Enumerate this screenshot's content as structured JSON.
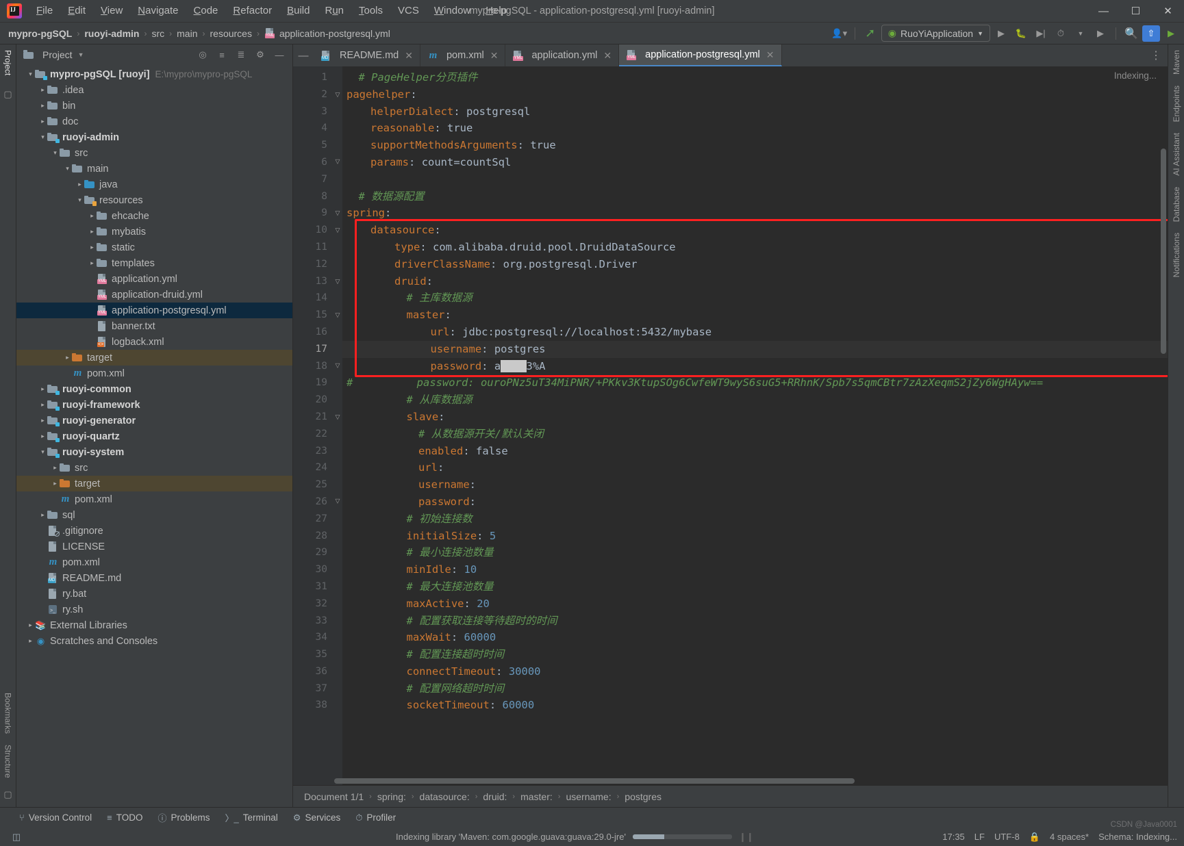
{
  "titlebar": {
    "logo_icon": "intellij-logo-icon",
    "title": "mypro-pgSQL - application-postgresql.yml [ruoyi-admin]",
    "menus": [
      {
        "label": "File",
        "mnemonic": "F"
      },
      {
        "label": "Edit",
        "mnemonic": "E"
      },
      {
        "label": "View",
        "mnemonic": "V"
      },
      {
        "label": "Navigate",
        "mnemonic": "N"
      },
      {
        "label": "Code",
        "mnemonic": "C"
      },
      {
        "label": "Refactor",
        "mnemonic": "R"
      },
      {
        "label": "Build",
        "mnemonic": "B"
      },
      {
        "label": "Run",
        "mnemonic": "u"
      },
      {
        "label": "Tools",
        "mnemonic": "T"
      },
      {
        "label": "VCS",
        "mnemonic": "V"
      },
      {
        "label": "Window",
        "mnemonic": "W"
      },
      {
        "label": "Help",
        "mnemonic": "H"
      }
    ],
    "window_controls": {
      "minimize": "—",
      "maximize": "☐",
      "close": "✕"
    }
  },
  "navbar": {
    "crumbs": [
      "mypro-pgSQL",
      "ruoyi-admin",
      "src",
      "main",
      "resources",
      "application-postgresql.yml"
    ],
    "separator": "›",
    "run_config": "RuoYiApplication",
    "icons": [
      "user-dropdown-icon",
      "update-project-icon",
      "run-icon",
      "debug-icon",
      "run-coverage-icon",
      "profiler-icon",
      "more-run-icon",
      "run-anything-icon",
      "search-icon",
      "updates-icon",
      "ide-icon"
    ]
  },
  "left_strip": {
    "tabs": [
      "Project",
      "Bookmarks",
      "Structure"
    ],
    "commit_icon": "commit-icon"
  },
  "right_strip": {
    "tabs": [
      "Maven",
      "Endpoints",
      "AI Assistant",
      "Database",
      "Notifications"
    ]
  },
  "project_panel": {
    "title": "Project",
    "toolbar_icons": [
      "locate-icon",
      "expand-all-icon",
      "collapse-all-icon",
      "settings-icon",
      "hide-icon"
    ],
    "tree": [
      {
        "depth": 0,
        "arrow": "down",
        "icon": "module-folder",
        "label": "mypro-pgSQL [ruoyi]",
        "bold": true,
        "hint": "E:\\mypro\\mypro-pgSQL"
      },
      {
        "depth": 1,
        "arrow": "right",
        "icon": "folder",
        "label": ".idea"
      },
      {
        "depth": 1,
        "arrow": "right",
        "icon": "folder",
        "label": "bin"
      },
      {
        "depth": 1,
        "arrow": "right",
        "icon": "folder",
        "label": "doc"
      },
      {
        "depth": 1,
        "arrow": "down",
        "icon": "module-folder",
        "label": "ruoyi-admin",
        "bold": true
      },
      {
        "depth": 2,
        "arrow": "down",
        "icon": "folder",
        "label": "src"
      },
      {
        "depth": 3,
        "arrow": "down",
        "icon": "folder",
        "label": "main"
      },
      {
        "depth": 4,
        "arrow": "right",
        "icon": "folder-blue",
        "label": "java"
      },
      {
        "depth": 4,
        "arrow": "down",
        "icon": "folder-res",
        "label": "resources"
      },
      {
        "depth": 5,
        "arrow": "right",
        "icon": "folder",
        "label": "ehcache"
      },
      {
        "depth": 5,
        "arrow": "right",
        "icon": "folder",
        "label": "mybatis"
      },
      {
        "depth": 5,
        "arrow": "right",
        "icon": "folder",
        "label": "static"
      },
      {
        "depth": 5,
        "arrow": "right",
        "icon": "folder",
        "label": "templates"
      },
      {
        "depth": 5,
        "arrow": "none",
        "icon": "yml",
        "label": "application.yml"
      },
      {
        "depth": 5,
        "arrow": "none",
        "icon": "yml",
        "label": "application-druid.yml"
      },
      {
        "depth": 5,
        "arrow": "none",
        "icon": "yml",
        "label": "application-postgresql.yml",
        "selected": true
      },
      {
        "depth": 5,
        "arrow": "none",
        "icon": "txt",
        "label": "banner.txt"
      },
      {
        "depth": 5,
        "arrow": "none",
        "icon": "xml",
        "label": "logback.xml"
      },
      {
        "depth": 3,
        "arrow": "right",
        "icon": "folder-orange",
        "label": "target",
        "target": true
      },
      {
        "depth": 3,
        "arrow": "none",
        "icon": "maven",
        "label": "pom.xml"
      },
      {
        "depth": 1,
        "arrow": "right",
        "icon": "module-folder",
        "label": "ruoyi-common",
        "bold": true
      },
      {
        "depth": 1,
        "arrow": "right",
        "icon": "module-folder",
        "label": "ruoyi-framework",
        "bold": true
      },
      {
        "depth": 1,
        "arrow": "right",
        "icon": "module-folder",
        "label": "ruoyi-generator",
        "bold": true
      },
      {
        "depth": 1,
        "arrow": "right",
        "icon": "module-folder",
        "label": "ruoyi-quartz",
        "bold": true
      },
      {
        "depth": 1,
        "arrow": "down",
        "icon": "module-folder",
        "label": "ruoyi-system",
        "bold": true
      },
      {
        "depth": 2,
        "arrow": "right",
        "icon": "folder",
        "label": "src"
      },
      {
        "depth": 2,
        "arrow": "right",
        "icon": "folder-orange",
        "label": "target",
        "target": true
      },
      {
        "depth": 2,
        "arrow": "none",
        "icon": "maven",
        "label": "pom.xml"
      },
      {
        "depth": 1,
        "arrow": "right",
        "icon": "folder",
        "label": "sql"
      },
      {
        "depth": 1,
        "arrow": "none",
        "icon": "gitignore",
        "label": ".gitignore"
      },
      {
        "depth": 1,
        "arrow": "none",
        "icon": "txt",
        "label": "LICENSE"
      },
      {
        "depth": 1,
        "arrow": "none",
        "icon": "maven",
        "label": "pom.xml"
      },
      {
        "depth": 1,
        "arrow": "none",
        "icon": "md",
        "label": "README.md"
      },
      {
        "depth": 1,
        "arrow": "none",
        "icon": "txt",
        "label": "ry.bat"
      },
      {
        "depth": 1,
        "arrow": "none",
        "icon": "sh",
        "label": "ry.sh"
      },
      {
        "depth": 0,
        "arrow": "right",
        "icon": "libraries",
        "label": "External Libraries"
      },
      {
        "depth": 0,
        "arrow": "right",
        "icon": "scratches",
        "label": "Scratches and Consoles"
      }
    ]
  },
  "editor": {
    "tabs": [
      {
        "label": "README.md",
        "icon": "md",
        "active": false,
        "closable": true
      },
      {
        "label": "pom.xml",
        "icon": "maven",
        "active": false,
        "closable": true
      },
      {
        "label": "application.yml",
        "icon": "yml",
        "active": false,
        "closable": true
      },
      {
        "label": "application-postgresql.yml",
        "icon": "yml",
        "active": true,
        "closable": true
      }
    ],
    "indexing_label": "Indexing...",
    "lines": [
      {
        "n": 1,
        "indent": 1,
        "type": "comment",
        "text": "# PageHelper分页插件"
      },
      {
        "n": 2,
        "indent": 0,
        "type": "kv",
        "key": "pagehelper",
        "value": "",
        "fold": "down"
      },
      {
        "n": 3,
        "indent": 2,
        "type": "kv",
        "key": "helperDialect",
        "value": "postgresql"
      },
      {
        "n": 4,
        "indent": 2,
        "type": "kv",
        "key": "reasonable",
        "value": "true"
      },
      {
        "n": 5,
        "indent": 2,
        "type": "kv",
        "key": "supportMethodsArguments",
        "value": "true"
      },
      {
        "n": 6,
        "indent": 2,
        "type": "kv",
        "key": "params",
        "value": "count=countSql",
        "fold": "end"
      },
      {
        "n": 7,
        "indent": 0,
        "type": "blank",
        "text": ""
      },
      {
        "n": 8,
        "indent": 1,
        "type": "comment",
        "text": "# 数据源配置"
      },
      {
        "n": 9,
        "indent": 0,
        "type": "kv",
        "key": "spring",
        "value": "",
        "fold": "down"
      },
      {
        "n": 10,
        "indent": 2,
        "type": "kv",
        "key": "datasource",
        "value": "",
        "fold": "down"
      },
      {
        "n": 11,
        "indent": 4,
        "type": "kv",
        "key": "type",
        "value": "com.alibaba.druid.pool.DruidDataSource"
      },
      {
        "n": 12,
        "indent": 4,
        "type": "kv",
        "key": "driverClassName",
        "value": "org.postgresql.Driver"
      },
      {
        "n": 13,
        "indent": 4,
        "type": "kv",
        "key": "druid",
        "value": "",
        "fold": "down"
      },
      {
        "n": 14,
        "indent": 5,
        "type": "comment",
        "text": "# 主库数据源"
      },
      {
        "n": 15,
        "indent": 5,
        "type": "kv",
        "key": "master",
        "value": "",
        "fold": "down"
      },
      {
        "n": 16,
        "indent": 7,
        "type": "kv",
        "key": "url",
        "value": "jdbc:postgresql://localhost:5432/mybase"
      },
      {
        "n": 17,
        "indent": 7,
        "type": "kv",
        "key": "username",
        "value": "postgres",
        "current": true
      },
      {
        "n": 18,
        "indent": 7,
        "type": "kv-redacted",
        "key": "password",
        "value": "ab███3%A",
        "fold": "end"
      },
      {
        "n": 19,
        "indent": 0,
        "type": "comment-long",
        "text": "#          password: ouroPNz5uT34MiPNR/+PKkv3KtupSOg6CwfeWT9wyS6suG5+RRhnK/Spb7s5qmCBtr7zAzXeqmS2jZy6WgHAyw=="
      },
      {
        "n": 20,
        "indent": 5,
        "type": "comment",
        "text": "# 从库数据源"
      },
      {
        "n": 21,
        "indent": 5,
        "type": "kv",
        "key": "slave",
        "value": "",
        "fold": "down"
      },
      {
        "n": 22,
        "indent": 6,
        "type": "comment",
        "text": "# 从数据源开关/默认关闭"
      },
      {
        "n": 23,
        "indent": 6,
        "type": "kv",
        "key": "enabled",
        "value": "false"
      },
      {
        "n": 24,
        "indent": 6,
        "type": "kv",
        "key": "url",
        "value": ""
      },
      {
        "n": 25,
        "indent": 6,
        "type": "kv",
        "key": "username",
        "value": ""
      },
      {
        "n": 26,
        "indent": 6,
        "type": "kv",
        "key": "password",
        "value": "",
        "fold": "end"
      },
      {
        "n": 27,
        "indent": 5,
        "type": "comment",
        "text": "# 初始连接数"
      },
      {
        "n": 28,
        "indent": 5,
        "type": "kv",
        "key": "initialSize",
        "value": "5",
        "numeric": true
      },
      {
        "n": 29,
        "indent": 5,
        "type": "comment",
        "text": "# 最小连接池数量"
      },
      {
        "n": 30,
        "indent": 5,
        "type": "kv",
        "key": "minIdle",
        "value": "10",
        "numeric": true
      },
      {
        "n": 31,
        "indent": 5,
        "type": "comment",
        "text": "# 最大连接池数量"
      },
      {
        "n": 32,
        "indent": 5,
        "type": "kv",
        "key": "maxActive",
        "value": "20",
        "numeric": true
      },
      {
        "n": 33,
        "indent": 5,
        "type": "comment",
        "text": "# 配置获取连接等待超时的时间"
      },
      {
        "n": 34,
        "indent": 5,
        "type": "kv",
        "key": "maxWait",
        "value": "60000",
        "numeric": true
      },
      {
        "n": 35,
        "indent": 5,
        "type": "comment",
        "text": "# 配置连接超时时间"
      },
      {
        "n": 36,
        "indent": 5,
        "type": "kv",
        "key": "connectTimeout",
        "value": "30000",
        "numeric": true
      },
      {
        "n": 37,
        "indent": 5,
        "type": "comment",
        "text": "# 配置网络超时时间"
      },
      {
        "n": 38,
        "indent": 5,
        "type": "kv",
        "key": "socketTimeout",
        "value": "60000",
        "numeric": true
      }
    ],
    "annotation": {
      "color": "#ff2020",
      "label": "red-highlight-box"
    },
    "breadcrumbs": [
      "Document 1/1",
      "spring:",
      "datasource:",
      "druid:",
      "master:",
      "username:",
      "postgres"
    ],
    "breadcrumb_separator": "›"
  },
  "bottom_bar": {
    "items": [
      {
        "label": "Version Control",
        "icon": "branch-icon"
      },
      {
        "label": "TODO",
        "icon": "todo-icon"
      },
      {
        "label": "Problems",
        "icon": "problems-icon"
      },
      {
        "label": "Terminal",
        "icon": "terminal-icon"
      },
      {
        "label": "Services",
        "icon": "services-icon"
      },
      {
        "label": "Profiler",
        "icon": "profiler-icon"
      }
    ]
  },
  "status_bar": {
    "message": "Indexing library 'Maven: com.google.guava:guava:29.0-jre'",
    "progress_percent": 32,
    "time": "17:35",
    "line_separator": "LF",
    "encoding": "UTF-8",
    "indent": "4 spaces*",
    "schema": "Schema: Indexing...",
    "watermark": "CSDN @Java0001",
    "pause_icon": "pause-icon",
    "lock_icon": "lock-icon",
    "memory_icon": "memory-icon"
  }
}
